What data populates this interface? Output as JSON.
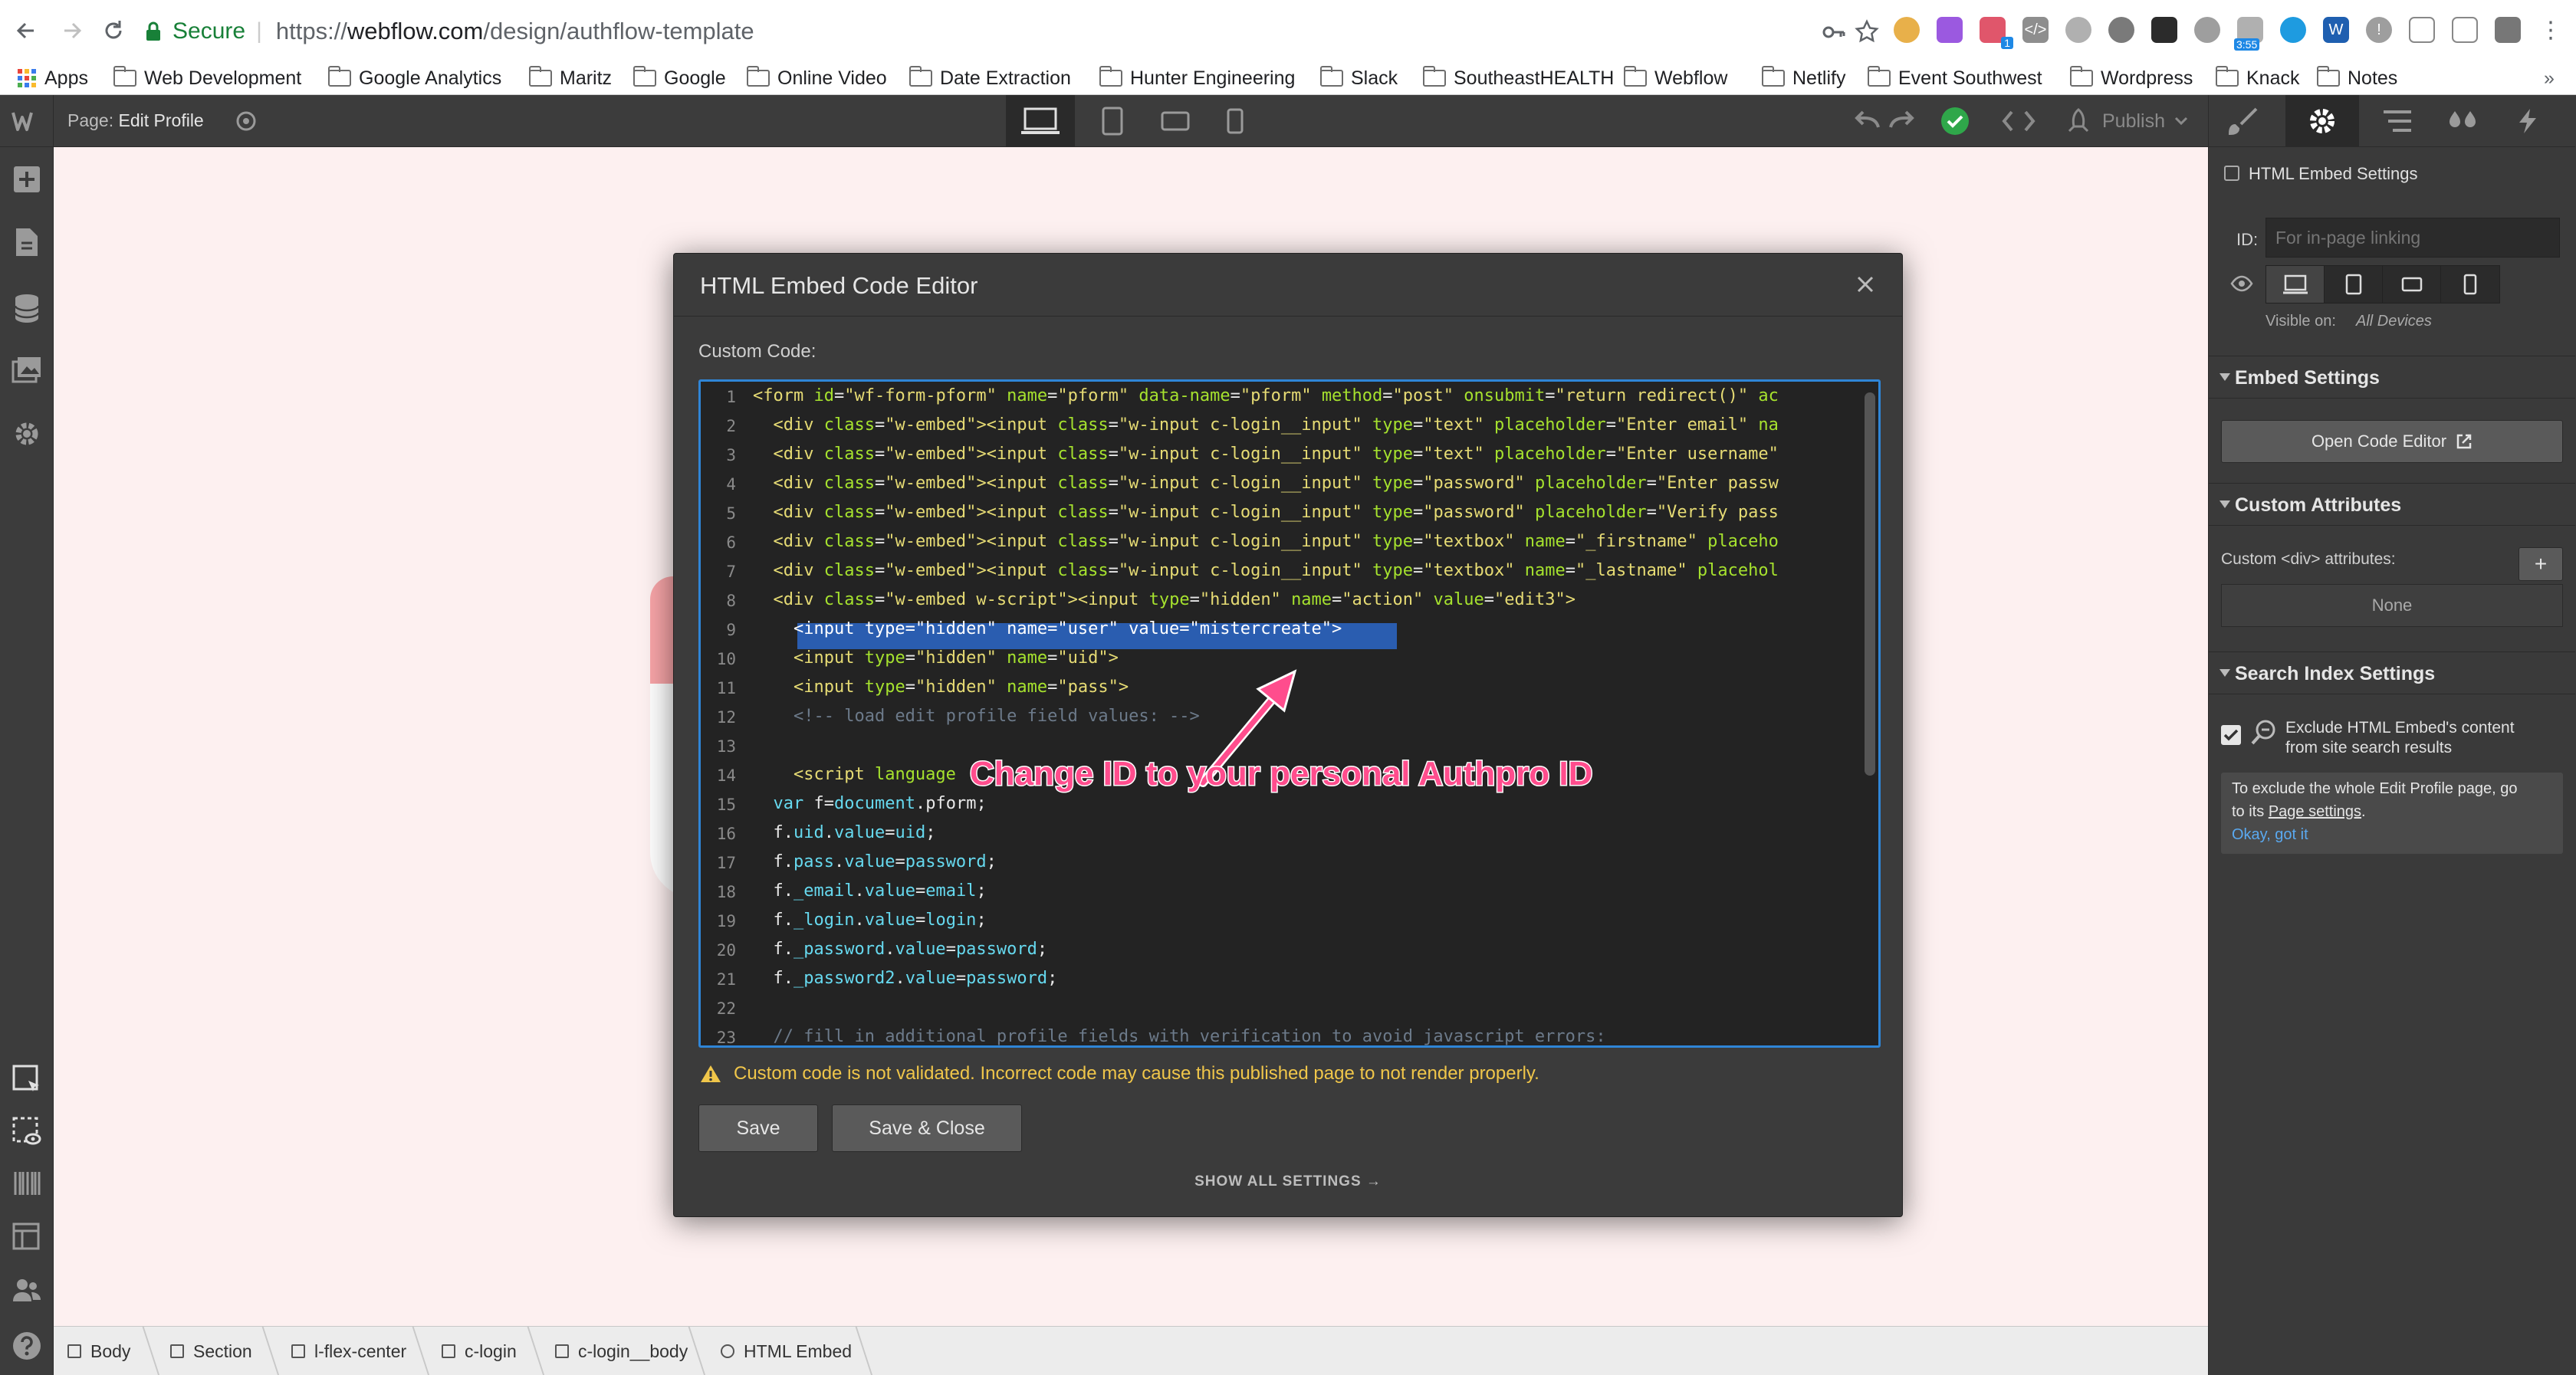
{
  "browser": {
    "secure_label": "Secure",
    "url_scheme": "https://",
    "url_host": "webflow.com",
    "url_path": "/design/authflow-template",
    "bookmarks": [
      "Apps",
      "Web Development",
      "Google Analytics",
      "Maritz",
      "Google",
      "Online Video",
      "Date Extraction",
      "Hunter Engineering",
      "Slack",
      "SoutheastHEALTH",
      "Webflow",
      "Netlify",
      "Event Southwest",
      "Wordpress",
      "Knack",
      "Notes"
    ],
    "extension_badge": "3:55",
    "extension_badge_small": "1"
  },
  "designer": {
    "page_prefix": "Page:",
    "page_name": "Edit Profile",
    "publish_label": "Publish"
  },
  "modal": {
    "title": "HTML Embed Code Editor",
    "custom_code_label": "Custom Code:",
    "warning": "Custom code is not validated. Incorrect code may cause this published page to not render properly.",
    "save_label": "Save",
    "save_close_label": "Save & Close",
    "show_all_label": "SHOW ALL SETTINGS →",
    "line_numbers": [
      "1",
      "2",
      "3",
      "4",
      "5",
      "6",
      "7",
      "8",
      "9",
      "10",
      "11",
      "12",
      "13",
      "14",
      "15",
      "16",
      "17",
      "18",
      "19",
      "20",
      "21",
      "22",
      "23"
    ]
  },
  "annotation": {
    "text": "Change ID to your personal Authpro ID"
  },
  "right_panel": {
    "header": "HTML Embed Settings",
    "id_label": "ID:",
    "id_placeholder": "For in-page linking",
    "visible_on_label": "Visible on:",
    "visible_on_value": "All Devices",
    "embed_settings_title": "Embed Settings",
    "open_code_editor": "Open Code Editor",
    "custom_attributes_title": "Custom Attributes",
    "custom_div_label": "Custom <div> attributes:",
    "attributes_value": "None",
    "search_index_title": "Search Index Settings",
    "exclude_label_1": "Exclude HTML Embed's content",
    "exclude_label_2": "from site search results",
    "tip_1": "To exclude the whole Edit Profile page, go",
    "tip_2_pre": "to its",
    "tip_2_link": "Page settings",
    "tip_2_post": ".",
    "tip_ok": "Okay, got it"
  },
  "breadcrumbs": [
    "Body",
    "Section",
    "l-flex-center",
    "c-login",
    "c-login__body",
    "HTML Embed"
  ],
  "colors": {
    "accent_blue": "#2f85d6",
    "annotation_pink": "#ff4d8d",
    "warning_yellow": "#f0c64a",
    "secure_green": "#188038"
  }
}
